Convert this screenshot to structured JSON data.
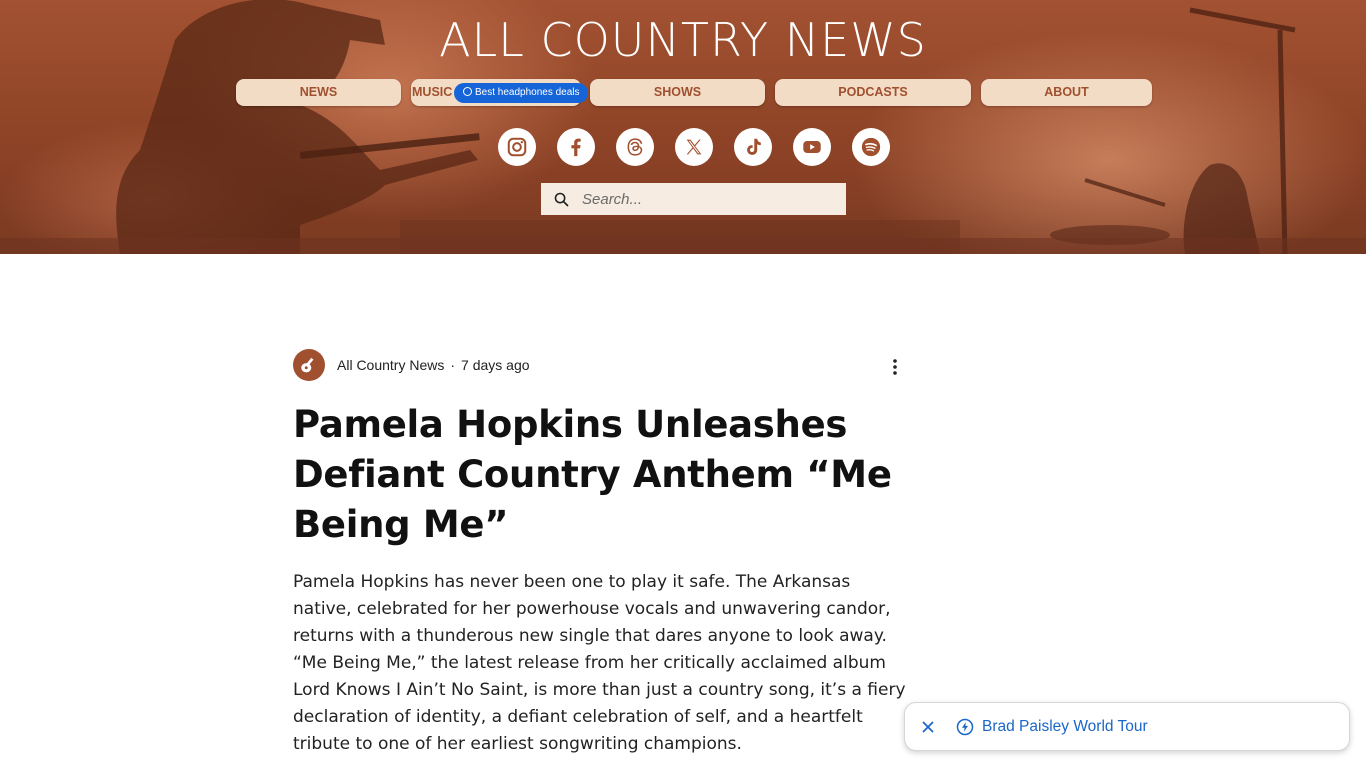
{
  "header": {
    "logo_text": "ALL COUNTRY NEWS",
    "nav": [
      {
        "label": "NEWS"
      },
      {
        "label": "MUSIC"
      },
      {
        "label": "SHOWS"
      },
      {
        "label": "PODCASTS"
      },
      {
        "label": "ABOUT"
      }
    ],
    "ad_pill": "Best headphones deals",
    "socials": [
      "instagram-icon",
      "facebook-icon",
      "threads-icon",
      "x-icon",
      "tiktok-icon",
      "youtube-icon",
      "spotify-icon"
    ],
    "search_placeholder": "Search..."
  },
  "post": {
    "author": "All Country News",
    "separator": "·",
    "time": "7 days ago",
    "title": "Pamela Hopkins Unleashes Defiant Country Anthem “Me Being Me”",
    "body": "Pamela Hopkins has never been one to play it safe. The Arkansas native, celebrated for her powerhouse vocals and unwavering candor, returns with a thunderous new single that dares anyone to look away. “Me Being Me,” the latest release from her critically acclaimed album Lord Knows I Ain’t No Saint, is more than just a country song, it’s a fiery declaration of identity, a defiant celebration of self, and a heartfelt tribute to one of her earliest songwriting champions."
  },
  "suggestion": {
    "label": "Brad Paisley World Tour"
  },
  "colors": {
    "header_brown": "#8e4326",
    "nav_button_bg": "#f3dcc6",
    "nav_text": "#a0502e",
    "ad_blue": "#1565d8",
    "link_blue": "#1a66c9"
  }
}
